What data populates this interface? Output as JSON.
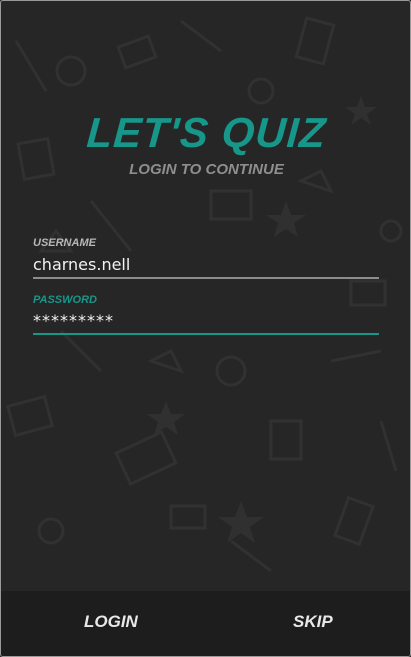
{
  "header": {
    "title": "LET'S QUIZ",
    "subtitle": "LOGIN TO CONTINUE"
  },
  "form": {
    "username_label": "USERNAME",
    "username_value": "charnes.nell",
    "password_label": "PASSWORD",
    "password_value": "*********"
  },
  "actions": {
    "login_label": "LOGIN",
    "skip_label": "SKIP"
  },
  "colors": {
    "accent": "#17968a",
    "background": "#262626"
  }
}
